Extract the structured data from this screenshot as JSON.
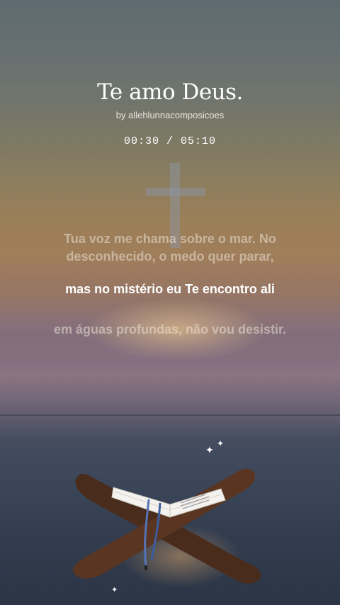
{
  "song": {
    "title": "Te amo Deus.",
    "byline": "by allehlunnacomposicoes",
    "time": "00:30 / 05:10"
  },
  "lyrics": {
    "previous": "Tua voz me chama sobre o mar. No desconhecido, o medo quer parar,",
    "current": "mas no mistério eu Te encontro ali",
    "next": "em águas profundas, não vou desistir."
  },
  "icons": {
    "cross": "cross-icon",
    "sparkle": "sparkle-icon",
    "bible_stand": "bible-stand-illustration"
  }
}
